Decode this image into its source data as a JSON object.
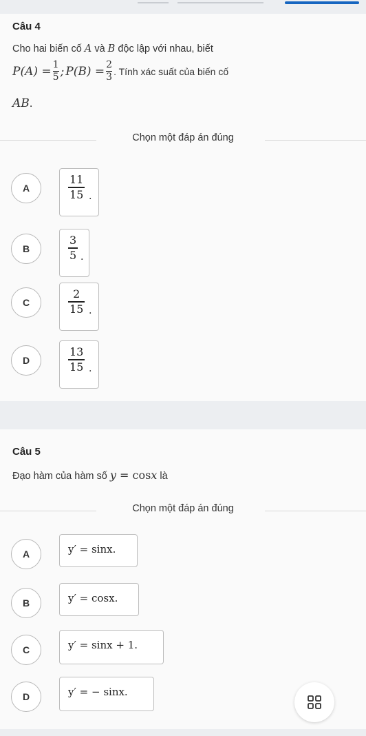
{
  "q4": {
    "title": "Câu 4",
    "intro": "Cho hai biến cố",
    "var_a": "A",
    "and_word": "và",
    "var_b": "B",
    "rest": "độc lập với nhau, biết",
    "pa_left": "P(A) =",
    "pa_num": "1",
    "pa_den": "5",
    "sep": ";",
    "pb_left": "P(B) =",
    "pb_num": "2",
    "pb_den": "3",
    "tail": ". Tính xác suất của biến cố",
    "ab": "AB",
    "ab_dot": ".",
    "choose": "Chọn một đáp án đúng",
    "options": [
      {
        "letter": "A",
        "num": "11",
        "den": "15"
      },
      {
        "letter": "B",
        "num": "3",
        "den": "5"
      },
      {
        "letter": "C",
        "num": "2",
        "den": "15"
      },
      {
        "letter": "D",
        "num": "13",
        "den": "15"
      }
    ]
  },
  "q5": {
    "title": "Câu 5",
    "text_before": "Đạo hàm của hàm số",
    "fn_y": "y",
    "fn_eq": " = ",
    "fn_cos": "cos",
    "fn_x": "x",
    "text_after": "là",
    "choose": "Chọn một đáp án đúng",
    "options": [
      {
        "letter": "A",
        "expr": "y′ = sinx."
      },
      {
        "letter": "B",
        "expr": "y′ = cosx."
      },
      {
        "letter": "C",
        "expr": "y′ = sinx + 1."
      },
      {
        "letter": "D",
        "expr": "y′ = − sinx."
      }
    ]
  },
  "fab_icon": "grid-icon"
}
